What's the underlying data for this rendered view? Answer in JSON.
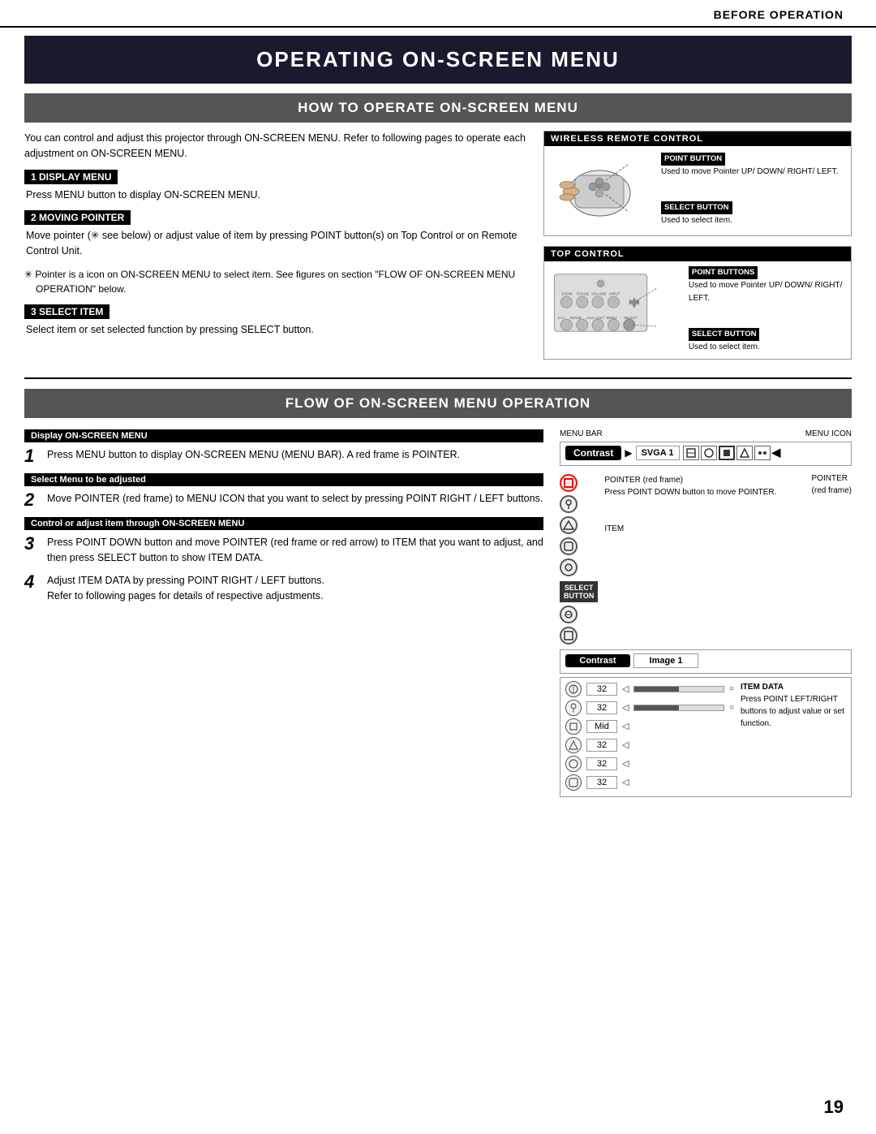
{
  "header": {
    "title": "BEFORE OPERATION"
  },
  "main_title": "OPERATING ON-SCREEN MENU",
  "section1": {
    "title": "HOW TO OPERATE ON-SCREEN MENU",
    "intro": "You can control and adjust this projector through ON-SCREEN MENU.  Refer to following pages to operate each adjustment on ON-SCREEN MENU.",
    "steps": [
      {
        "label": "1  DISPLAY MENU",
        "text": "Press MENU button to display ON-SCREEN MENU."
      },
      {
        "label": "2  MOVING POINTER",
        "text": "Move pointer (✳ see below) or adjust value of item by pressing POINT button(s) on Top Control or on Remote Control Unit."
      },
      {
        "label": "3  SELECT ITEM",
        "text": "Select item or set selected function by pressing SELECT button."
      }
    ],
    "note": "✳  Pointer is a icon on ON-SCREEN MENU to select item. See figures on section \"FLOW OF ON-SCREEN MENU OPERATION\" below.",
    "remote_box": {
      "header": "WIRELESS REMOTE CONTROL",
      "point_button_label": "POINT BUTTON",
      "point_button_desc": "Used to move Pointer UP/ DOWN/ RIGHT/ LEFT.",
      "select_button_label": "SELECT BUTTON",
      "select_button_desc": "Used to select item."
    },
    "top_control_box": {
      "header": "TOP CONTROL",
      "point_buttons_label": "POINT BUTTONS",
      "point_buttons_desc": "Used to move Pointer UP/ DOWN/ RIGHT/ LEFT.",
      "select_button_label": "SELECT BUTTON",
      "select_button_desc": "Used to select item."
    }
  },
  "section2": {
    "title": "FLOW OF ON-SCREEN MENU OPERATION",
    "display_step": {
      "label": "Display ON-SCREEN MENU",
      "number": "1",
      "text": "Press MENU button to display ON-SCREEN MENU (MENU BAR).  A red frame is POINTER."
    },
    "select_step": {
      "label": "Select Menu to be adjusted",
      "number": "2",
      "text": "Move POINTER (red frame) to MENU ICON that you want to select by pressing POINT RIGHT / LEFT buttons."
    },
    "control_step": {
      "label": "Control or adjust item through ON-SCREEN MENU",
      "number": "3",
      "text": "Press POINT DOWN button and move POINTER (red frame or red arrow) to ITEM that you want to adjust, and then press SELECT button to show ITEM DATA."
    },
    "step4": {
      "number": "4",
      "text1": "Adjust ITEM DATA by pressing POINT RIGHT / LEFT buttons.",
      "text2": "Refer to following pages for details of respective adjustments."
    },
    "diagram": {
      "menu_bar_label": "MENU BAR",
      "menu_icon_label": "MENU ICON",
      "contrast_label": "Contrast",
      "svga_label": "SVGA 1",
      "pointer_label": "POINTER (red frame)",
      "pointer_desc": "Press POINT DOWN button to move POINTER.",
      "item_label": "ITEM",
      "pointer_red_frame_label": "POINTER",
      "pointer_red_frame_sub": "(red frame)",
      "item_data_label": "ITEM DATA",
      "item_data_desc": "Press POINT LEFT/RIGHT buttons to adjust value or set function.",
      "contrast_bottom": "Contrast",
      "image_label": "Image 1",
      "values": [
        "32",
        "32",
        "Mid",
        "32",
        "32",
        "32"
      ],
      "select_button_label": "SELECT\nBUTTON"
    }
  },
  "page_number": "19"
}
